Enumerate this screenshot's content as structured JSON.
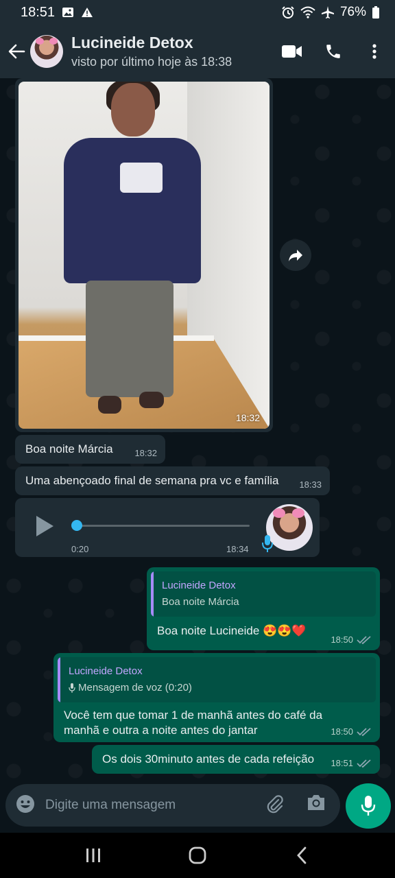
{
  "status_bar": {
    "time": "18:51",
    "battery": "76%",
    "icons": [
      "image-icon",
      "warning-icon",
      "alarm-icon",
      "wifi-icon",
      "airplane-icon",
      "battery-icon"
    ]
  },
  "header": {
    "contact_name": "Lucineide Detox",
    "last_seen": "visto por último hoje às 18:38"
  },
  "messages": {
    "image": {
      "time": "18:32"
    },
    "m1": {
      "text": "Boa noite  Márcia",
      "time": "18:32"
    },
    "m2": {
      "text": "Uma abençoado final de semana pra vc e família",
      "time": "18:33"
    },
    "voice": {
      "duration": "0:20",
      "time": "18:34",
      "progress": 0.0
    },
    "out1": {
      "quote_name": "Lucineide Detox",
      "quote_text": "Boa noite  Márcia",
      "text": "Boa noite Lucineide 😍😍❤️",
      "time": "18:50"
    },
    "out2": {
      "quote_name": "Lucineide Detox",
      "quote_text": "Mensagem de voz (0:20)",
      "text": "Você tem que tomar 1 de manhã antes do café da manhã e outra a noite antes do jantar",
      "time": "18:50"
    },
    "out3": {
      "text": "Os dois 30minuto antes de cada refeição",
      "time": "18:51"
    }
  },
  "input": {
    "placeholder": "Digite uma mensagem",
    "value": ""
  },
  "colors": {
    "accent": "#00a884",
    "outgoing": "#005c4b",
    "incoming": "#1f2c34",
    "background": "#0b141a",
    "read_ticks": "#8fa7b3"
  }
}
